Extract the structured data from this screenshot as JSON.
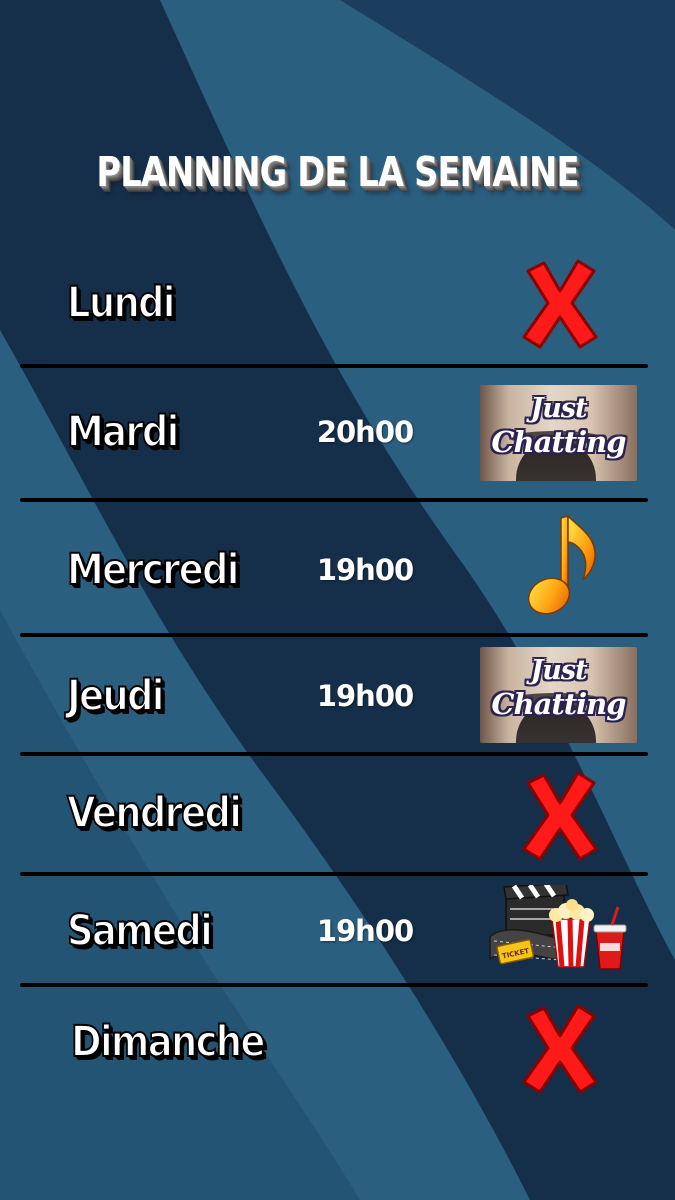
{
  "title": "PLANNING DE LA SEMAINE",
  "colors": {
    "background": "#2b5f80",
    "stripe_dark": "#122a45",
    "cross_red": "#ff1a1a"
  },
  "days": [
    {
      "name": "Lundi",
      "time": "",
      "activity": "cross-icon"
    },
    {
      "name": "Mardi",
      "time": "20h00",
      "activity": "just-chatting-thumbnail"
    },
    {
      "name": "Mercredi",
      "time": "19h00",
      "activity": "music-note-icon"
    },
    {
      "name": "Jeudi",
      "time": "19h00",
      "activity": "just-chatting-thumbnail"
    },
    {
      "name": "Vendredi",
      "time": "",
      "activity": "cross-icon"
    },
    {
      "name": "Samedi",
      "time": "19h00",
      "activity": "cinema-icon"
    },
    {
      "name": "Dimanche",
      "time": "",
      "activity": "cross-icon"
    }
  ],
  "just_chatting": {
    "line1": "Just",
    "line2": "Chatting"
  },
  "ticket_label": "TICKET"
}
